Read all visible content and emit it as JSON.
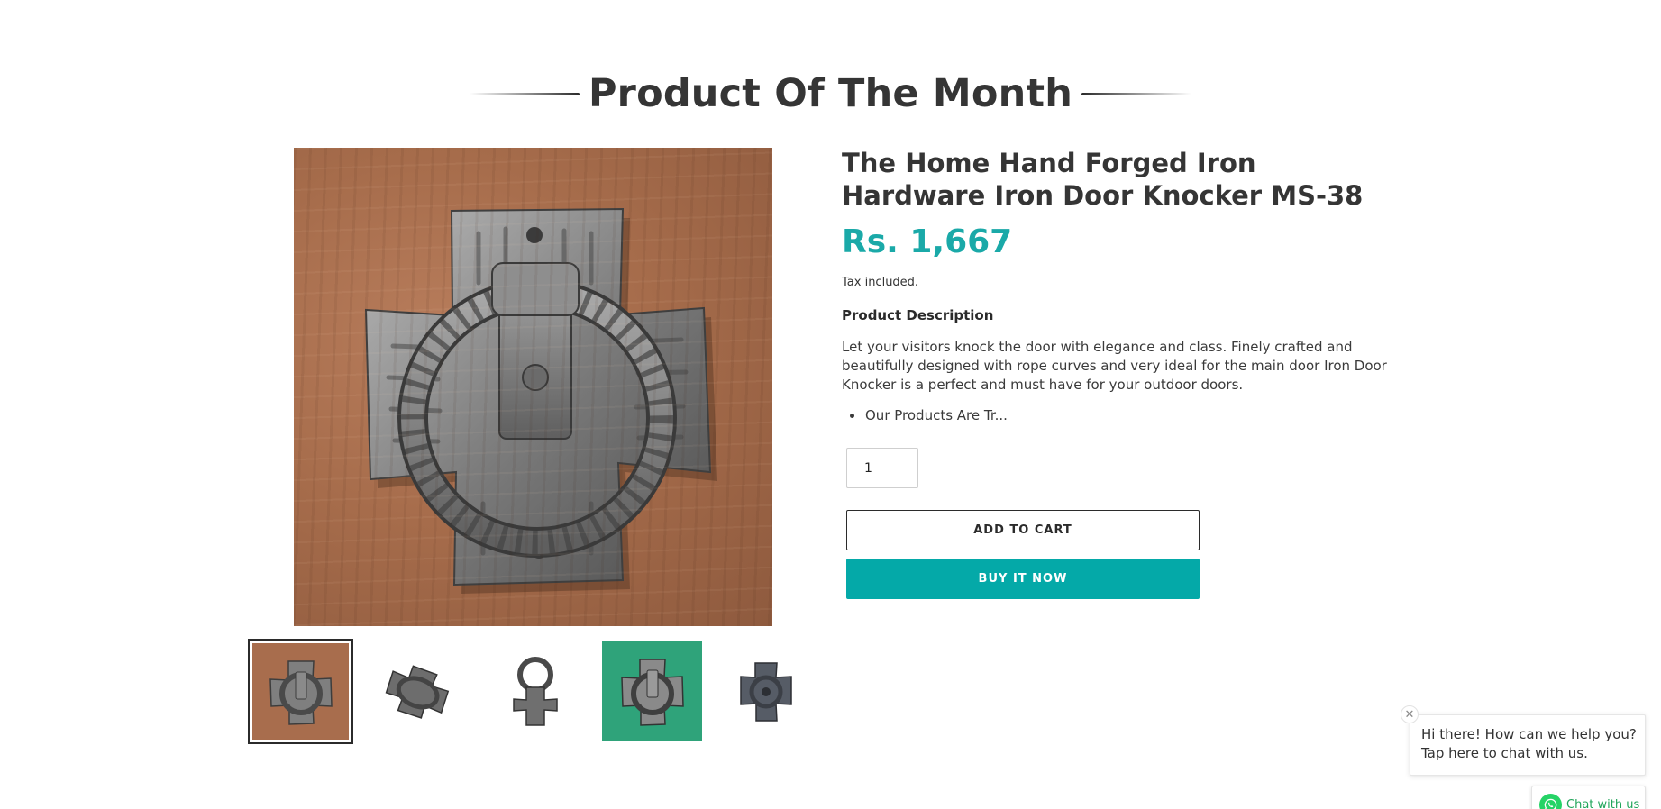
{
  "section": {
    "heading": "Product Of The Month"
  },
  "product": {
    "title": "The Home Hand Forged Iron Hardware Iron Door Knocker MS-38",
    "price": "Rs. 1,667",
    "tax_note": "Tax included.",
    "description_heading": "Product Description",
    "description": "Let your visitors knock the door with elegance and class. Finely crafted and beautifully designed with rope curves and very ideal for the main door Iron Door Knocker is a perfect and must have for your outdoor doors.",
    "bullets": [
      "Our Products Are Tr..."
    ],
    "quantity": "1",
    "add_to_cart_label": "ADD TO CART",
    "buy_now_label": "BUY IT NOW",
    "accent_color": "#04a9a8"
  },
  "gallery": {
    "thumbnails": [
      {
        "name": "door-knocker-front-rust",
        "active": true
      },
      {
        "name": "door-knocker-angled"
      },
      {
        "name": "door-knocker-side"
      },
      {
        "name": "door-knocker-front-green"
      },
      {
        "name": "door-knocker-back"
      }
    ]
  },
  "chat": {
    "popup_line1": "Hi there! How can we help you?",
    "popup_line2": "Tap here to chat with us.",
    "close_icon": "close-icon",
    "button_label": "Chat with us",
    "button_icon": "whatsapp-icon",
    "brand_color": "#25d366"
  }
}
